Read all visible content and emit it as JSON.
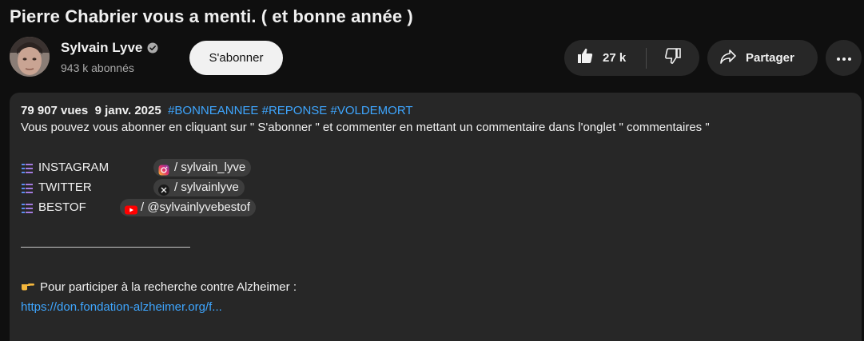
{
  "video": {
    "title": "Pierre Chabrier vous a menti. ( et bonne année )"
  },
  "channel": {
    "name": "Sylvain Lyve",
    "subscribers": "943 k abonnés",
    "subscribe_label": "S'abonner"
  },
  "actions": {
    "like_count": "27 k",
    "share_label": "Partager"
  },
  "description": {
    "views": "79 907 vues",
    "date": "9 janv. 2025",
    "hashtags": [
      "#BONNEANNEE",
      "#REPONSE",
      "#VOLDEMORT"
    ],
    "intro": "Vous pouvez vous abonner en cliquant sur \" S'abonner \" et commenter en mettant un commentaire dans l'onglet \" commentaires \"",
    "socials": [
      {
        "name": "INSTAGRAM",
        "handle": "/ sylvain_lyve",
        "icon": "instagram-icon"
      },
      {
        "name": "TWITTER",
        "handle": "/ sylvainlyve",
        "icon": "x-icon"
      },
      {
        "name": "BESTOF",
        "handle": "/ @sylvainlyvebestof",
        "icon": "youtube-icon"
      }
    ],
    "alzheimer_text": "Pour participer à la recherche contre Alzheimer :",
    "alzheimer_link": "https://don.fondation-alzheimer.org/f..."
  },
  "colors": {
    "background": "#0f0f0f",
    "panel": "#272727",
    "link": "#3ea6ff",
    "subscribe_bg": "#f1f1f1"
  }
}
